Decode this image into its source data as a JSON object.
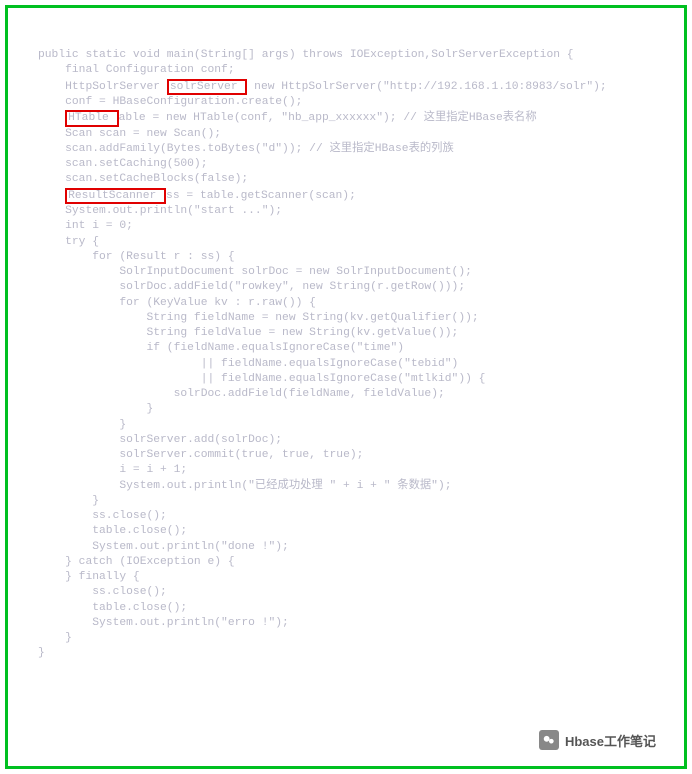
{
  "code": {
    "l01_a": "public static void main(String[] args) throws IOException,SolrServerException {",
    "l02": "    final Configuration conf;",
    "l03_a": "    HttpSolrServer ",
    "l03_hl": "solrServer ",
    "l03_b": " new HttpSolrServer(\"http://192.168.1.10:8983/solr\");",
    "l04": "    conf = HBaseConfiguration.create();",
    "l05_a": "    ",
    "l05_hl": "HTable ",
    "l05_b": "able = new HTable(conf, \"hb_app_xxxxxx\"); // 这里指定HBase表名称",
    "l06": "    Scan scan = new Scan();",
    "l07": "    scan.addFamily(Bytes.toBytes(\"d\")); // 这里指定HBase表的列族",
    "l08": "    scan.setCaching(500);",
    "l09": "    scan.setCacheBlocks(false);",
    "l10_a": "    ",
    "l10_hl": "ResultScanner ",
    "l10_b": "ss = table.getScanner(scan);",
    "l11": "    System.out.println(\"start ...\");",
    "l12": "    int i = 0;",
    "l13": "    try {",
    "l14": "        for (Result r : ss) {",
    "l15": "            SolrInputDocument solrDoc = new SolrInputDocument();",
    "l16": "            solrDoc.addField(\"rowkey\", new String(r.getRow()));",
    "l17": "            for (KeyValue kv : r.raw()) {",
    "l18": "                String fieldName = new String(kv.getQualifier());",
    "l19": "                String fieldValue = new String(kv.getValue());",
    "l20": "                if (fieldName.equalsIgnoreCase(\"time\")",
    "l21": "                        || fieldName.equalsIgnoreCase(\"tebid\")",
    "l22": "                        || fieldName.equalsIgnoreCase(\"mtlkid\")) {",
    "l23": "                    solrDoc.addField(fieldName, fieldValue);",
    "l24": "                }",
    "l25": "            }",
    "l26": "            solrServer.add(solrDoc);",
    "l27": "            solrServer.commit(true, true, true);",
    "l28": "            i = i + 1;",
    "l29": "            System.out.println(\"已经成功处理 \" + i + \" 条数据\");",
    "l30": "        }",
    "l31": "        ss.close();",
    "l32": "        table.close();",
    "l33": "        System.out.println(\"done !\");",
    "l34": "    } catch (IOException e) {",
    "l35": "    } finally {",
    "l36": "        ss.close();",
    "l37": "        table.close();",
    "l38": "        System.out.println(\"erro !\");",
    "l39": "    }",
    "l40": "}"
  },
  "footer": {
    "label": "Hbase工作笔记"
  }
}
